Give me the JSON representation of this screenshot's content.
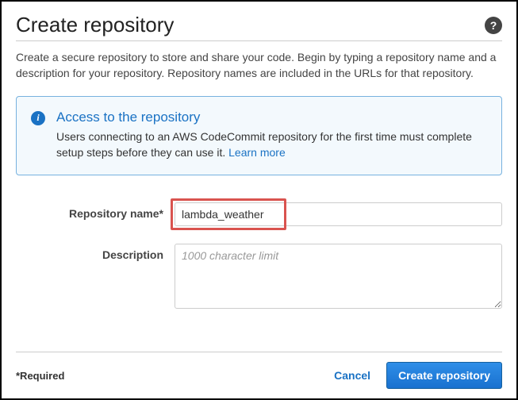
{
  "header": {
    "title": "Create repository",
    "help_glyph": "?"
  },
  "intro_text": "Create a secure repository to store and share your code. Begin by typing a repository name and a description for your repository. Repository names are included in the URLs for that repository.",
  "info": {
    "icon_glyph": "i",
    "title": "Access to the repository",
    "body": "Users connecting to an AWS CodeCommit repository for the first time must complete setup steps before they can use it. ",
    "learn_more": "Learn more"
  },
  "form": {
    "name_label": "Repository name*",
    "name_value": "lambda_weather",
    "description_label": "Description",
    "description_placeholder": "1000 character limit"
  },
  "footer": {
    "required_note": "*Required",
    "cancel_label": "Cancel",
    "submit_label": "Create repository"
  }
}
